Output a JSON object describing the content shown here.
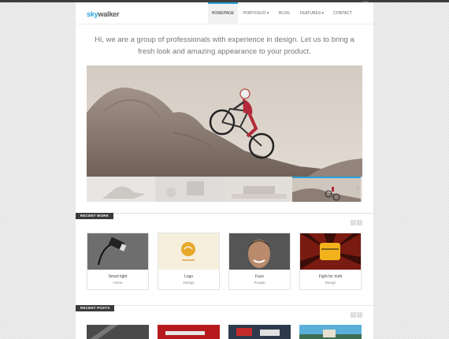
{
  "brand": {
    "sky": "sky",
    "walker": "walker"
  },
  "nav": {
    "items": [
      {
        "label": "HOMEPAGE"
      },
      {
        "label": "PORTFOLIO ▾"
      },
      {
        "label": "BLOG"
      },
      {
        "label": "FEATURES ▾"
      },
      {
        "label": "CONTACT"
      }
    ],
    "active_index": 0
  },
  "intro": {
    "text": "Hi, we are a group of professionals with experience in design. Let us to bring a fresh look and amazing appearance to your product."
  },
  "slider": {
    "active_thumb_index": 3
  },
  "recent_work": {
    "label": "RECENT WORK",
    "items": [
      {
        "title": "Smart light",
        "category": "Home"
      },
      {
        "title": "Logo",
        "category": "Design"
      },
      {
        "title": "Face",
        "category": "People"
      },
      {
        "title": "Fight for truth",
        "category": "Design"
      }
    ]
  },
  "recent_posts": {
    "label": "RECENT POSTS"
  },
  "colors": {
    "accent": "#2aa3d8",
    "label_bg": "#3a3a3a"
  }
}
